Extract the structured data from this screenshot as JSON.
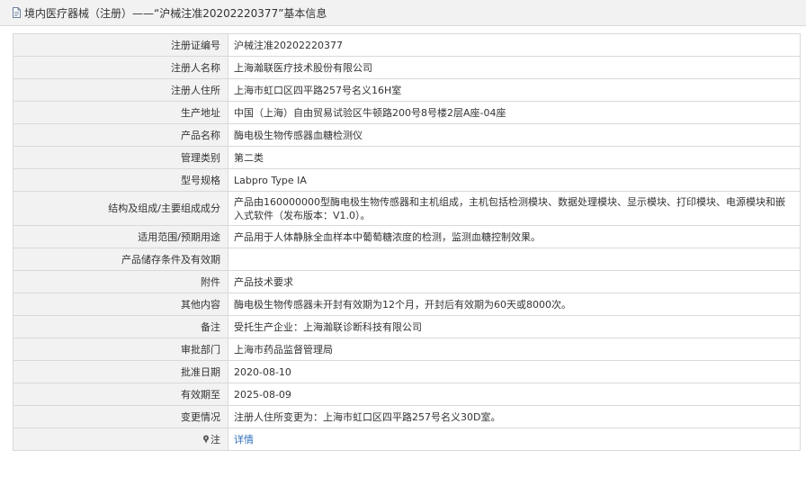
{
  "header": {
    "icon": "document-icon",
    "title": "境内医疗器械（注册）——“沪械注准20202220377”基本信息"
  },
  "rows": [
    {
      "label": "注册证编号",
      "value": "沪械注准20202220377"
    },
    {
      "label": "注册人名称",
      "value": "上海瀚联医疗技术股份有限公司"
    },
    {
      "label": "注册人住所",
      "value": "上海市虹口区四平路257号名义16H室"
    },
    {
      "label": "生产地址",
      "value": "中国（上海）自由贸易试验区牛顿路200号8号楼2层A座-04座"
    },
    {
      "label": "产品名称",
      "value": "酶电极生物传感器血糖检测仪"
    },
    {
      "label": "管理类别",
      "value": "第二类"
    },
    {
      "label": "型号规格",
      "value": "Labpro Type IA"
    },
    {
      "label": "结构及组成/主要组成成分",
      "value": "产品由160000000型酶电极生物传感器和主机组成，主机包括检测模块、数据处理模块、显示模块、打印模块、电源模块和嵌入式软件（发布版本：V1.0）。"
    },
    {
      "label": "适用范围/预期用途",
      "value": "产品用于人体静脉全血样本中葡萄糖浓度的检测，监测血糖控制效果。"
    },
    {
      "label": "产品储存条件及有效期",
      "value": ""
    },
    {
      "label": "附件",
      "value": "产品技术要求"
    },
    {
      "label": "其他内容",
      "value": "酶电极生物传感器未开封有效期为12个月，开封后有效期为60天或8000次。"
    },
    {
      "label": "备注",
      "value": "受托生产企业：上海瀚联诊断科技有限公司"
    },
    {
      "label": "审批部门",
      "value": "上海市药品监督管理局"
    },
    {
      "label": "批准日期",
      "value": "2020-08-10"
    },
    {
      "label": "有效期至",
      "value": "2025-08-09"
    },
    {
      "label": "变更情况",
      "value": "注册人住所变更为：上海市虹口区四平路257号名义30D室。"
    }
  ],
  "note_row": {
    "icon": "pin-icon",
    "label": "注",
    "link_text": "详情"
  }
}
